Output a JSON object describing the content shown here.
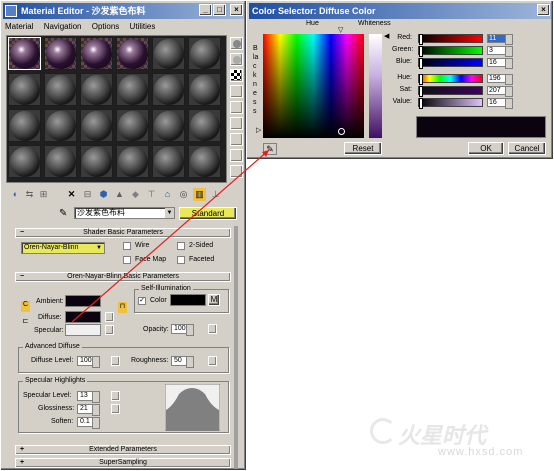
{
  "material_editor": {
    "title": "Material Editor - 沙发紫色布料",
    "menu": [
      "Material",
      "Navigation",
      "Options",
      "Utilities"
    ],
    "material_name": "沙发紫色布料",
    "material_type": "Standard",
    "shader_rollout": "Shader Basic Parameters",
    "shader_type": "Oren-Nayar-Blinn",
    "shader_options": {
      "wire": "Wire",
      "two_sided": "2-Sided",
      "face_map": "Face Map",
      "faceted": "Faceted"
    },
    "params_rollout": "Oren-Nayar-Blinn Basic Parameters",
    "ambient_label": "Ambient:",
    "diffuse_label": "Diffuse:",
    "specular_label": "Specular:",
    "lock_label": "C",
    "self_illum": {
      "title": "Self-Illumination",
      "color_label": "Color",
      "m_label": "M"
    },
    "opacity": {
      "label": "Opacity:",
      "value": "100"
    },
    "advanced_diffuse": {
      "title": "Advanced Diffuse",
      "diffuse_level_label": "Diffuse Level:",
      "diffuse_level": "100",
      "roughness_label": "Roughness:",
      "roughness": "50"
    },
    "specular_highlights": {
      "title": "Specular Highlights",
      "level_label": "Specular Level:",
      "level": "13",
      "gloss_label": "Glossiness:",
      "gloss": "21",
      "soften_label": "Soften:",
      "soften": "0.1"
    },
    "extended_rollout": "Extended Parameters",
    "supersampling_rollout": "SuperSampling",
    "rollout_sign": "+"
  },
  "color_selector": {
    "title": "Color Selector: Diffuse Color",
    "hue_label": "Hue",
    "whiteness_label": "Whiteness",
    "blackness_label": "Blackness",
    "reset_label": "Reset",
    "ok_label": "OK",
    "cancel_label": "Cancel",
    "red_label": "Red:",
    "red": "11",
    "green_label": "Green:",
    "green": "3",
    "blue_label": "Blue:",
    "blue": "16",
    "hue_val_label": "Hue:",
    "hue": "196",
    "sat_label": "Sat:",
    "sat": "207",
    "value_label": "Value:",
    "value": "16",
    "current_color": "#0b0310"
  },
  "watermark": {
    "brand": "火星时代",
    "url": "www.hxsd.com"
  },
  "icons": [
    "eyedropper-icon",
    "close-icon",
    "minimize-icon",
    "maximize-icon",
    "lock-icon",
    "sphere-icon",
    "checker-icon"
  ]
}
